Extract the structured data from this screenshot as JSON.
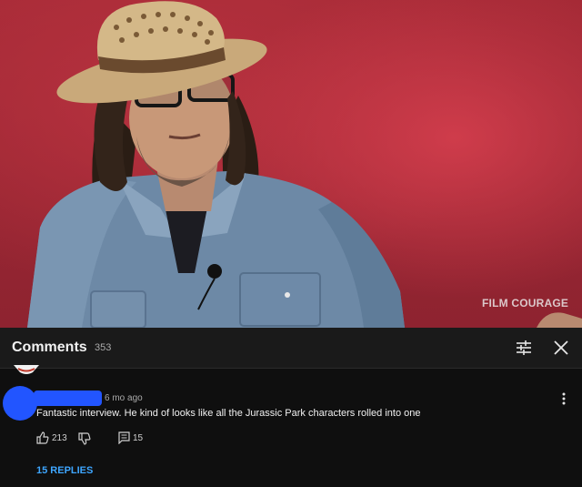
{
  "video": {
    "watermark": "FILM COURAGE",
    "scene": "interview-speaker-straw-hat-red-backdrop"
  },
  "comments_panel": {
    "title": "Comments",
    "count": "353",
    "filter_icon": "sliders-icon",
    "close_icon": "close-icon"
  },
  "comment": {
    "avatar_color": "#2255ff",
    "time": "6 mo ago",
    "text": "Fantastic interview. He kind of looks like all the Jurassic Park characters rolled into one",
    "likes": "213",
    "replies_count": "15",
    "view_replies": "15 REPLIES"
  },
  "colors": {
    "background": "#0f0f0f",
    "header": "#1a1a1a",
    "link": "#3ea6ff",
    "redaction": "#2255ff"
  }
}
